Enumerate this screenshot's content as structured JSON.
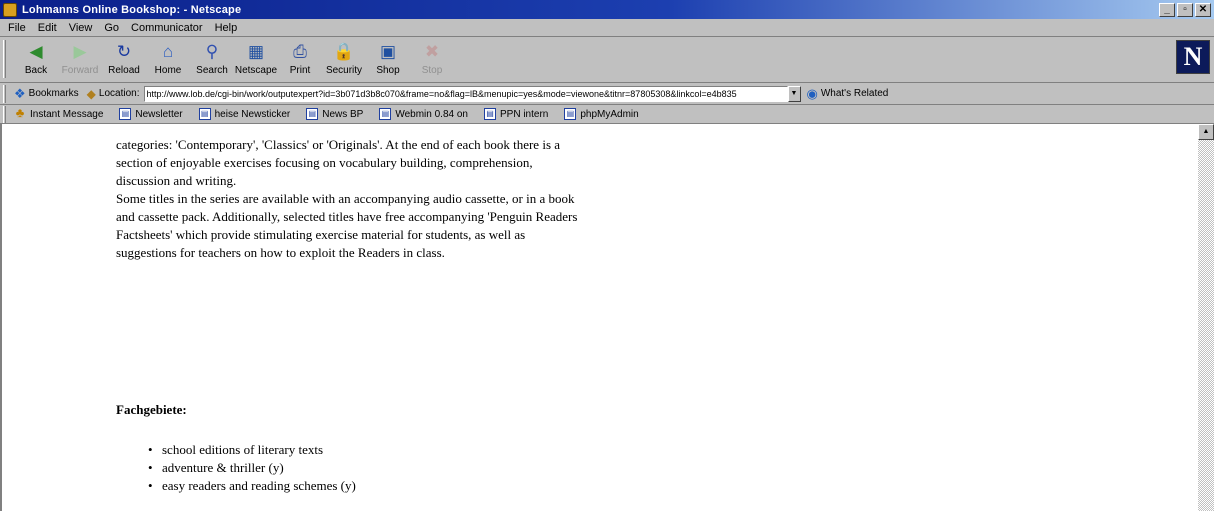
{
  "window": {
    "title": "Lohmanns Online Bookshop: - Netscape"
  },
  "menu": [
    "File",
    "Edit",
    "View",
    "Go",
    "Communicator",
    "Help"
  ],
  "toolbar": [
    {
      "label": "Back",
      "icon": "back-arrow-icon",
      "glyph": "◀",
      "color": "#2e8b2e",
      "disabled": false
    },
    {
      "label": "Forward",
      "icon": "forward-arrow-icon",
      "glyph": "▶",
      "color": "#9ac89a",
      "disabled": true
    },
    {
      "label": "Reload",
      "icon": "reload-icon",
      "glyph": "↻",
      "color": "#1a3aa0",
      "disabled": false
    },
    {
      "label": "Home",
      "icon": "home-icon",
      "glyph": "⌂",
      "color": "#3060c0",
      "disabled": false
    },
    {
      "label": "Search",
      "icon": "search-icon",
      "glyph": "⚲",
      "color": "#3050b0",
      "disabled": false
    },
    {
      "label": "Netscape",
      "icon": "netscape-icon",
      "glyph": "▦",
      "color": "#2050a0",
      "disabled": false
    },
    {
      "label": "Print",
      "icon": "print-icon",
      "glyph": "⎙",
      "color": "#3050a0",
      "disabled": false
    },
    {
      "label": "Security",
      "icon": "security-lock-icon",
      "glyph": "🔒",
      "color": "#b08020",
      "disabled": false
    },
    {
      "label": "Shop",
      "icon": "shop-icon",
      "glyph": "▣",
      "color": "#2050a0",
      "disabled": false
    },
    {
      "label": "Stop",
      "icon": "stop-icon",
      "glyph": "✖",
      "color": "#c0a0a0",
      "disabled": true
    }
  ],
  "location": {
    "bookmarks_label": "Bookmarks",
    "location_label": "Location:",
    "url": "http://www.lob.de/cgi-bin/work/outputexpert?id=3b071d3b8c070&frame=no&flag=lB&menupic=yes&mode=viewone&titnr=87805308&linkcol=e4b835",
    "related_label": "What's Related"
  },
  "personal_toolbar": [
    {
      "label": "Instant Message",
      "icon": "instant-message-icon"
    },
    {
      "label": "Newsletter",
      "icon": "bookmark-page-icon"
    },
    {
      "label": "heise Newsticker",
      "icon": "bookmark-page-icon"
    },
    {
      "label": "News BP",
      "icon": "bookmark-page-icon"
    },
    {
      "label": "Webmin 0.84 on",
      "icon": "bookmark-page-icon"
    },
    {
      "label": "PPN intern",
      "icon": "bookmark-page-icon"
    },
    {
      "label": "phpMyAdmin",
      "icon": "bookmark-page-icon"
    }
  ],
  "content": {
    "paragraphs": [
      "categories: 'Contemporary', 'Classics' or 'Originals'. At the end of each book there is a section of enjoyable exercises focusing on vocabulary building, comprehension, discussion and writing.",
      "Some titles in the series are available with an accompanying audio cassette, or in a book and cassette pack. Additionally, selected titles have free accompanying 'Penguin Readers Factsheets' which provide stimulating exercise material for students, as well as suggestions for teachers on how to exploit the Readers in class."
    ],
    "section_title": "Fachgebiete:",
    "topics": [
      "school editions of literary texts",
      "adventure & thriller (y)",
      "easy readers and reading schemes (y)"
    ]
  }
}
